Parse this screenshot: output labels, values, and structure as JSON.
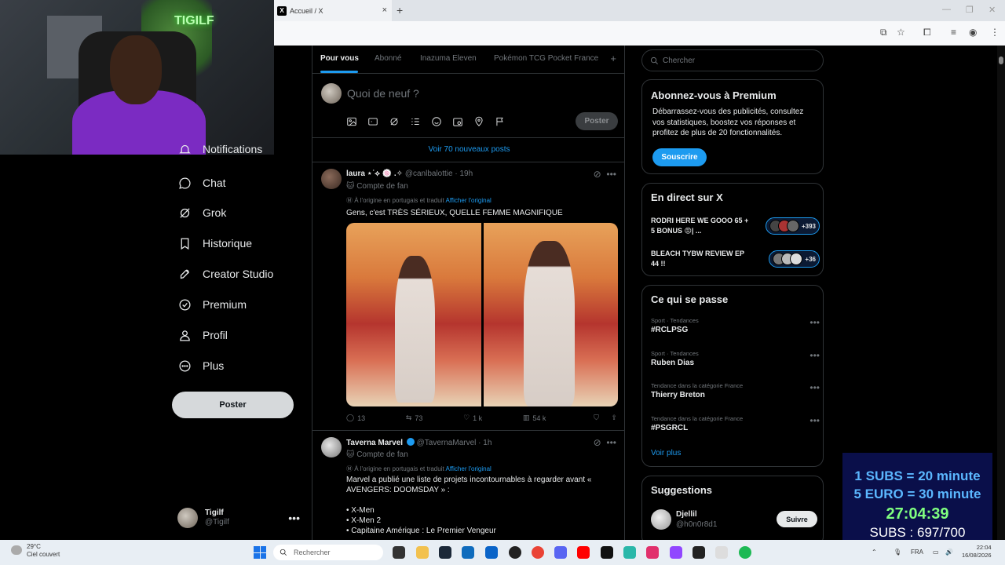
{
  "browser": {
    "tab_title": "Accueil / X",
    "tab_icon": "x-logo-icon",
    "close_glyph": "×",
    "newtab_glyph": "+"
  },
  "overlay_text": {
    "neon": "TIGILF",
    "nav_cut": "Notifications"
  },
  "nav": {
    "items": [
      {
        "label": "Chat",
        "icon": "chat-icon"
      },
      {
        "label": "Grok",
        "icon": "grok-icon"
      },
      {
        "label": "Historique",
        "icon": "bookmark-icon"
      },
      {
        "label": "Creator Studio",
        "icon": "rocket-icon"
      },
      {
        "label": "Premium",
        "icon": "verified-icon"
      },
      {
        "label": "Profil",
        "icon": "user-icon"
      },
      {
        "label": "Plus",
        "icon": "more-circle-icon"
      }
    ],
    "post_label": "Poster",
    "account_name": "Tigilf",
    "account_handle": "@Tigilf",
    "account_more": "•••"
  },
  "timeline": {
    "tabs": [
      "Pour vous",
      "Abonné",
      "Inazuma Eleven",
      "Pokémon TCG Pocket France"
    ],
    "tab_add": "+",
    "compose_placeholder": "Quoi de neuf ?",
    "compose_post": "Poster",
    "new_posts": "Voir 70 nouveaux posts",
    "tweets": [
      {
        "name": "laura ⋆˙⟡ 🍥 .✧",
        "handle": "@canlbalottie",
        "time": "· 19h",
        "fan": "🐱 Compte de fan",
        "translated": "Ⓜ À l'origine en portugais et traduit",
        "show_original": "Afficher l'original",
        "text": "Gens, c'est TRÈS SÉRIEUX, QUELLE FEMME MAGNIFIQUE",
        "replies": "13",
        "reposts": "73",
        "likes": "1 k",
        "views": "54 k"
      },
      {
        "name": "Taverna Marvel",
        "handle": "@TavernaMarvel",
        "time": "· 1h",
        "fan": "🐱 Compte de fan",
        "translated": "Ⓜ À l'origine en portugais et traduit",
        "show_original": "Afficher l'original",
        "text": "Marvel a publié une liste de projets incontournables à regarder avant « AVENGERS: DOOMSDAY » :\n\n• X-Men\n• X-Men 2\n• Capitaine Amérique : Le Premier Vengeur"
      }
    ]
  },
  "sidebar": {
    "search_placeholder": "Chercher",
    "premium": {
      "title": "Abonnez-vous à Premium",
      "text": "Débarrassez-vous des publicités, consultez vos statistiques, boostez vos réponses et profitez de plus de 20 fonctionnalités.",
      "button": "Souscrire"
    },
    "live": {
      "title": "En direct sur X",
      "items": [
        {
          "title": "RODRI HERE WE GOOO 65 + 5 BONUS 😡| ...",
          "count": "+393"
        },
        {
          "title": "BLEACH TYBW REVIEW EP 44 !!",
          "count": "+36"
        }
      ]
    },
    "trends": {
      "title": "Ce qui se passe",
      "items": [
        {
          "category": "Sport · Tendances",
          "name": "#RCLPSG"
        },
        {
          "category": "Sport · Tendances",
          "name": "Ruben Dias"
        },
        {
          "category": "Tendance dans la catégorie France",
          "name": "Thierry Breton"
        },
        {
          "category": "Tendance dans la catégorie France",
          "name": "#PSGRCL"
        }
      ],
      "more_glyph": "•••",
      "see_more": "Voir plus"
    },
    "suggestions": {
      "title": "Suggestions",
      "name": "Djellil",
      "handle": "@h0n0r8d1",
      "follow": "Suivre"
    }
  },
  "stream": {
    "line1": "1 SUBS = 20 minute",
    "line2": "5 EURO = 30 minute",
    "timer": "27:04:39",
    "subs": "SUBS : 697/700"
  },
  "taskbar": {
    "temp": "29°C",
    "weather": "Ciel couvert",
    "search": "Rechercher",
    "lang": "FRA",
    "time": "22:04",
    "date": "16/08/2026"
  },
  "colors": {
    "accent": "#1d9bf0",
    "background": "#000000",
    "premium_button": "#1d9bf0",
    "overlay_bg": "#0a0f4a"
  }
}
